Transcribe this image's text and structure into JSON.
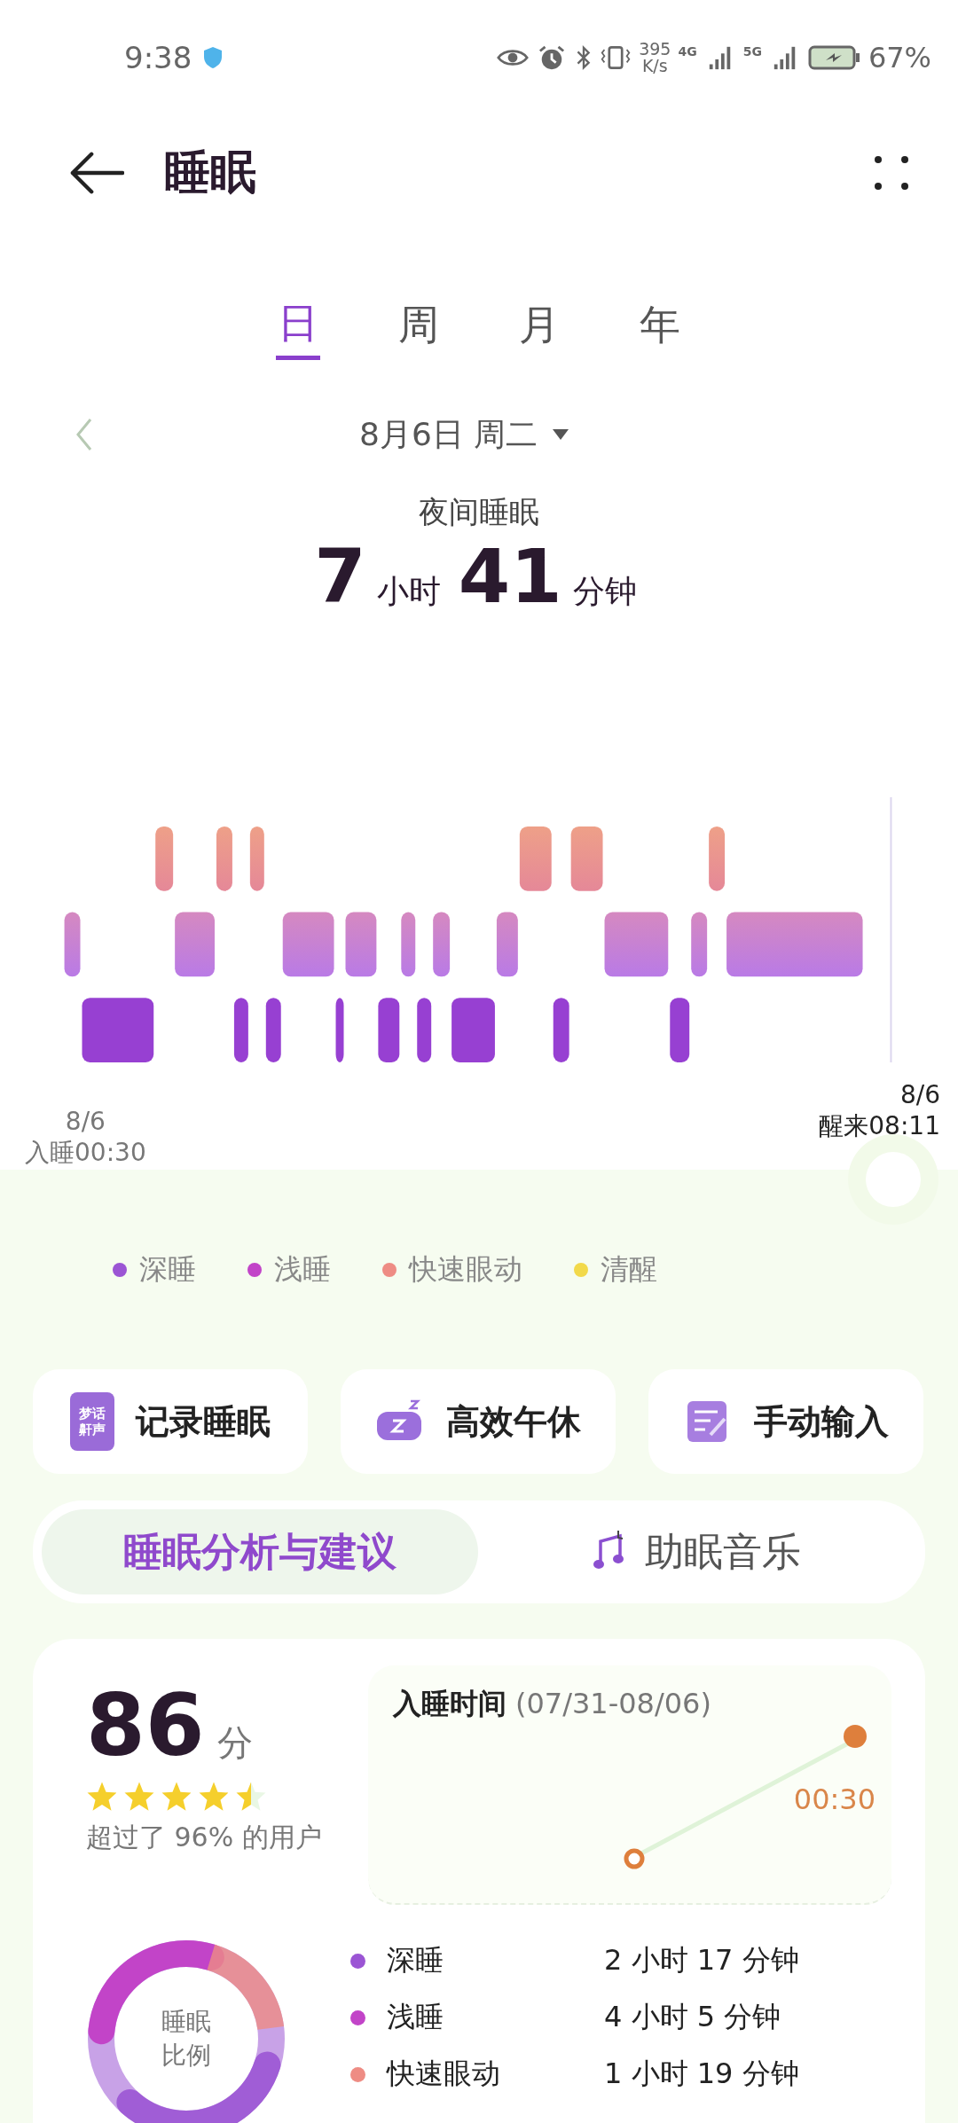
{
  "status_bar": {
    "time": "9:38",
    "net_speed": "395",
    "net_unit": "K/s",
    "net_4g": "4G",
    "net_5g": "5G",
    "battery": "67%"
  },
  "header": {
    "title": "睡眠"
  },
  "tabs": [
    {
      "label": "日",
      "selected": true
    },
    {
      "label": "周",
      "selected": false
    },
    {
      "label": "月",
      "selected": false
    },
    {
      "label": "年",
      "selected": false
    }
  ],
  "date": {
    "label": "8月6日 周二"
  },
  "summary": {
    "title": "夜间睡眠",
    "hours": "7",
    "hours_unit": "小时",
    "minutes": "41",
    "minutes_unit": "分钟"
  },
  "hypnogram": {
    "start_date": "8/6",
    "start_label": "入睡00:30",
    "end_date": "8/6",
    "end_label": "醒来08:11"
  },
  "legend": [
    {
      "label": "深睡",
      "color": "#9b55d4"
    },
    {
      "label": "浅睡",
      "color": "#c244c8"
    },
    {
      "label": "快速眼动",
      "color": "#ee8c84"
    },
    {
      "label": "清醒",
      "color": "#f2d94a"
    }
  ],
  "actions": [
    {
      "label": "记录睡眠",
      "kind": "record",
      "icon_lines": [
        "梦话",
        "鼾声"
      ]
    },
    {
      "label": "高效午休",
      "kind": "nap"
    },
    {
      "label": "手动输入",
      "kind": "manual"
    }
  ],
  "sections": [
    {
      "label": "睡眠分析与建议",
      "kind": "text",
      "selected": true
    },
    {
      "label": "助眠音乐",
      "kind": "music",
      "selected": false
    }
  ],
  "score": {
    "value": "86",
    "unit": "分",
    "stars": 4.5,
    "note": "超过了 96% 的用户"
  },
  "bedtime": {
    "title": "入睡时间",
    "range": "(07/31-08/06)",
    "latest": "00:30"
  },
  "ratio": {
    "title_lines": [
      "睡眠",
      "比例"
    ]
  },
  "rows": [
    {
      "label": "深睡",
      "value": "2 小时 17 分钟",
      "color": "#9b55d4"
    },
    {
      "label": "浅睡",
      "value": "4 小时 5 分钟",
      "color": "#c244c8"
    },
    {
      "label": "快速眼动",
      "value": "1 小时 19 分钟",
      "color": "#ee8c84"
    }
  ]
}
